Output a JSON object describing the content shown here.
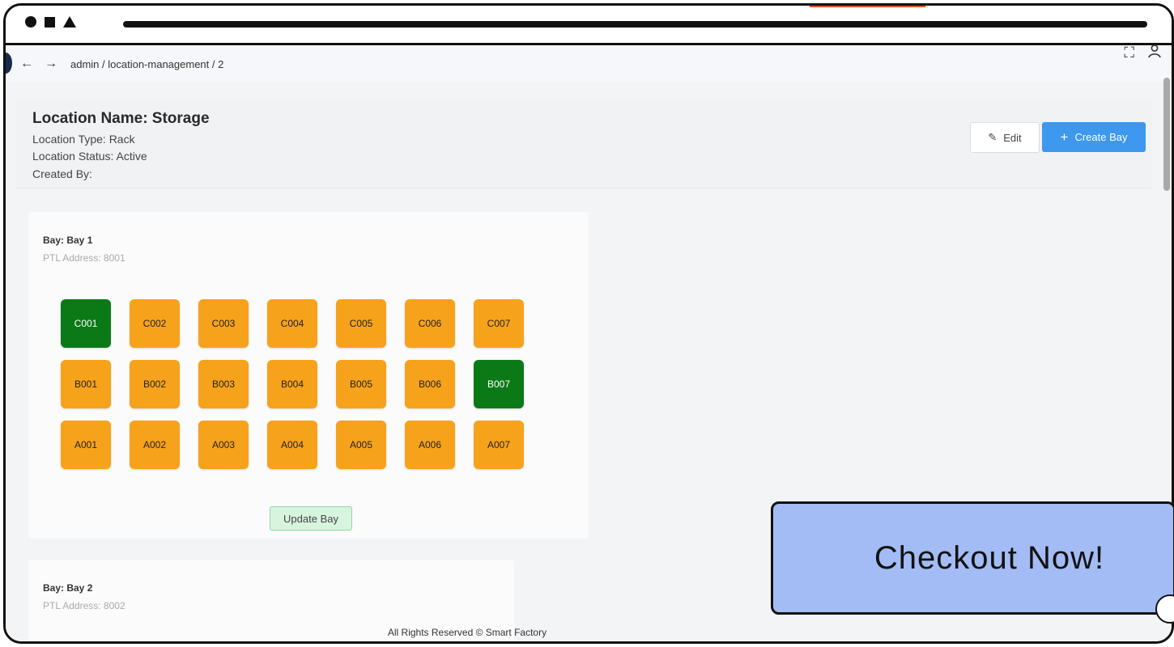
{
  "navbar": {
    "back_icon": "←",
    "forward_icon": "→",
    "breadcrumb": "admin  / location-management  / 2",
    "fullscreen_icon": "⛶",
    "user_icon": "👤"
  },
  "header": {
    "location_name": "Location Name: Storage",
    "location_type": "Location Type: Rack",
    "location_status": "Location Status: Active",
    "created_by": "Created By:",
    "edit_label": "Edit",
    "edit_icon": "✎",
    "create_label": "Create Bay",
    "create_icon": "+"
  },
  "bays": [
    {
      "title": "Bay: Bay 1",
      "ptl": "PTL Address: 8001",
      "cells": [
        {
          "label": "C001",
          "status": "green"
        },
        {
          "label": "C002",
          "status": "orange"
        },
        {
          "label": "C003",
          "status": "orange"
        },
        {
          "label": "C004",
          "status": "orange"
        },
        {
          "label": "C005",
          "status": "orange"
        },
        {
          "label": "C006",
          "status": "orange"
        },
        {
          "label": "C007",
          "status": "orange"
        },
        {
          "label": "B001",
          "status": "orange"
        },
        {
          "label": "B002",
          "status": "orange"
        },
        {
          "label": "B003",
          "status": "orange"
        },
        {
          "label": "B004",
          "status": "orange"
        },
        {
          "label": "B005",
          "status": "orange"
        },
        {
          "label": "B006",
          "status": "orange"
        },
        {
          "label": "B007",
          "status": "green"
        },
        {
          "label": "A001",
          "status": "orange"
        },
        {
          "label": "A002",
          "status": "orange"
        },
        {
          "label": "A003",
          "status": "orange"
        },
        {
          "label": "A004",
          "status": "orange"
        },
        {
          "label": "A005",
          "status": "orange"
        },
        {
          "label": "A006",
          "status": "orange"
        },
        {
          "label": "A007",
          "status": "orange"
        }
      ],
      "update_label": "Update Bay"
    },
    {
      "title": "Bay: Bay 2",
      "ptl": "PTL Address: 8002"
    }
  ],
  "footer": "All Rights Reserved © Smart Factory",
  "checkout": "Checkout Now!",
  "colors": {
    "occupied": "#0b7a16",
    "available": "#f7a21b",
    "primary": "#3d98ee",
    "update": "#d7f5de"
  }
}
